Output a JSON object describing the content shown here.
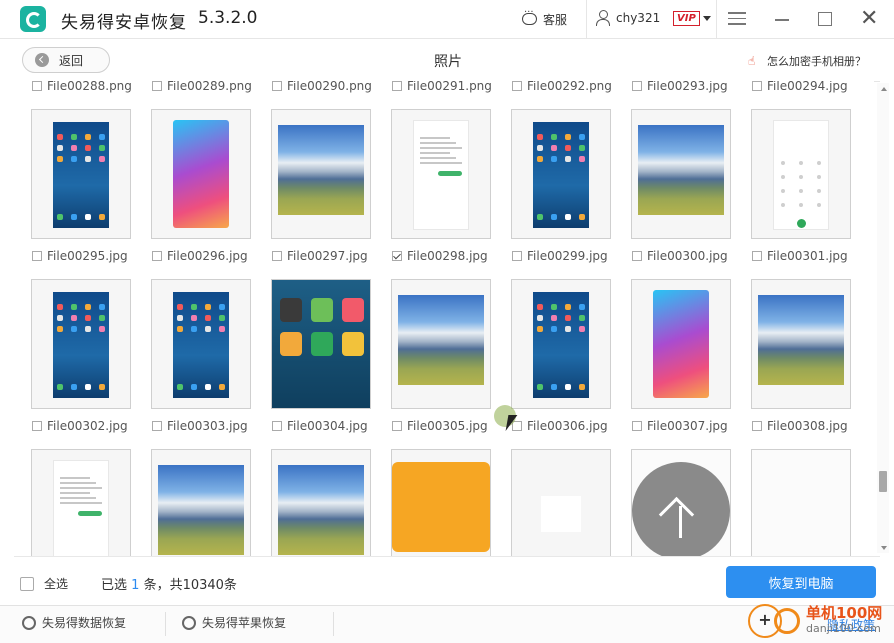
{
  "app": {
    "title": "失易得安卓恢复",
    "version": "5.3.2.0"
  },
  "titlebar": {
    "service_label": "客服",
    "username": "chy321",
    "vip_label": "VIP"
  },
  "header": {
    "back_label": "返回",
    "page_title": "照片",
    "help_link": "怎么加密手机相册？"
  },
  "grid": {
    "top_row_labels": [
      "File00288.png",
      "File00289.png",
      "File00290.png",
      "File00291.png",
      "File00292.png",
      "File00293.jpg",
      "File00294.jpg"
    ],
    "row1": [
      {
        "name": "File00295.jpg",
        "checked": false,
        "kind": "phone-blue"
      },
      {
        "name": "File00296.jpg",
        "checked": false,
        "kind": "phone-gradient"
      },
      {
        "name": "File00297.jpg",
        "checked": false,
        "kind": "landscape"
      },
      {
        "name": "File00298.jpg",
        "checked": true,
        "kind": "chat"
      },
      {
        "name": "File00299.jpg",
        "checked": false,
        "kind": "phone-blue"
      },
      {
        "name": "File00300.jpg",
        "checked": false,
        "kind": "landscape"
      },
      {
        "name": "File00301.jpg",
        "checked": false,
        "kind": "dialer"
      }
    ],
    "row2": [
      {
        "name": "File00302.jpg",
        "checked": false,
        "kind": "phone-blue"
      },
      {
        "name": "File00303.jpg",
        "checked": false,
        "kind": "phone-blue"
      },
      {
        "name": "File00304.jpg",
        "checked": false,
        "kind": "app-icons"
      },
      {
        "name": "File00305.jpg",
        "checked": false,
        "kind": "landscape"
      },
      {
        "name": "File00306.jpg",
        "checked": false,
        "kind": "phone-blue"
      },
      {
        "name": "File00307.jpg",
        "checked": false,
        "kind": "phone-gradient"
      },
      {
        "name": "File00308.jpg",
        "checked": false,
        "kind": "landscape"
      }
    ],
    "row3": [
      {
        "kind": "chat"
      },
      {
        "kind": "landscape"
      },
      {
        "kind": "landscape"
      },
      {
        "kind": "orange"
      },
      {
        "kind": "blank-square"
      },
      {
        "kind": "blank"
      },
      {
        "kind": "blank"
      }
    ]
  },
  "bottombar": {
    "select_all_label": "全选",
    "selected_prefix": "已选",
    "selected_count": "1",
    "selected_suffix": "条，共10340条",
    "recover_label": "恢复到电脑"
  },
  "footer": {
    "data_recovery_label": "失易得数据恢复",
    "apple_recovery_label": "失易得苹果恢复",
    "privacy_label": "隐私政策"
  },
  "watermark": {
    "line1": "单机100网",
    "line2": "danji100.com"
  },
  "colors": {
    "accent": "#2d8ff0",
    "vip": "#d4202c",
    "teal_logo": "#1bb3a0"
  }
}
